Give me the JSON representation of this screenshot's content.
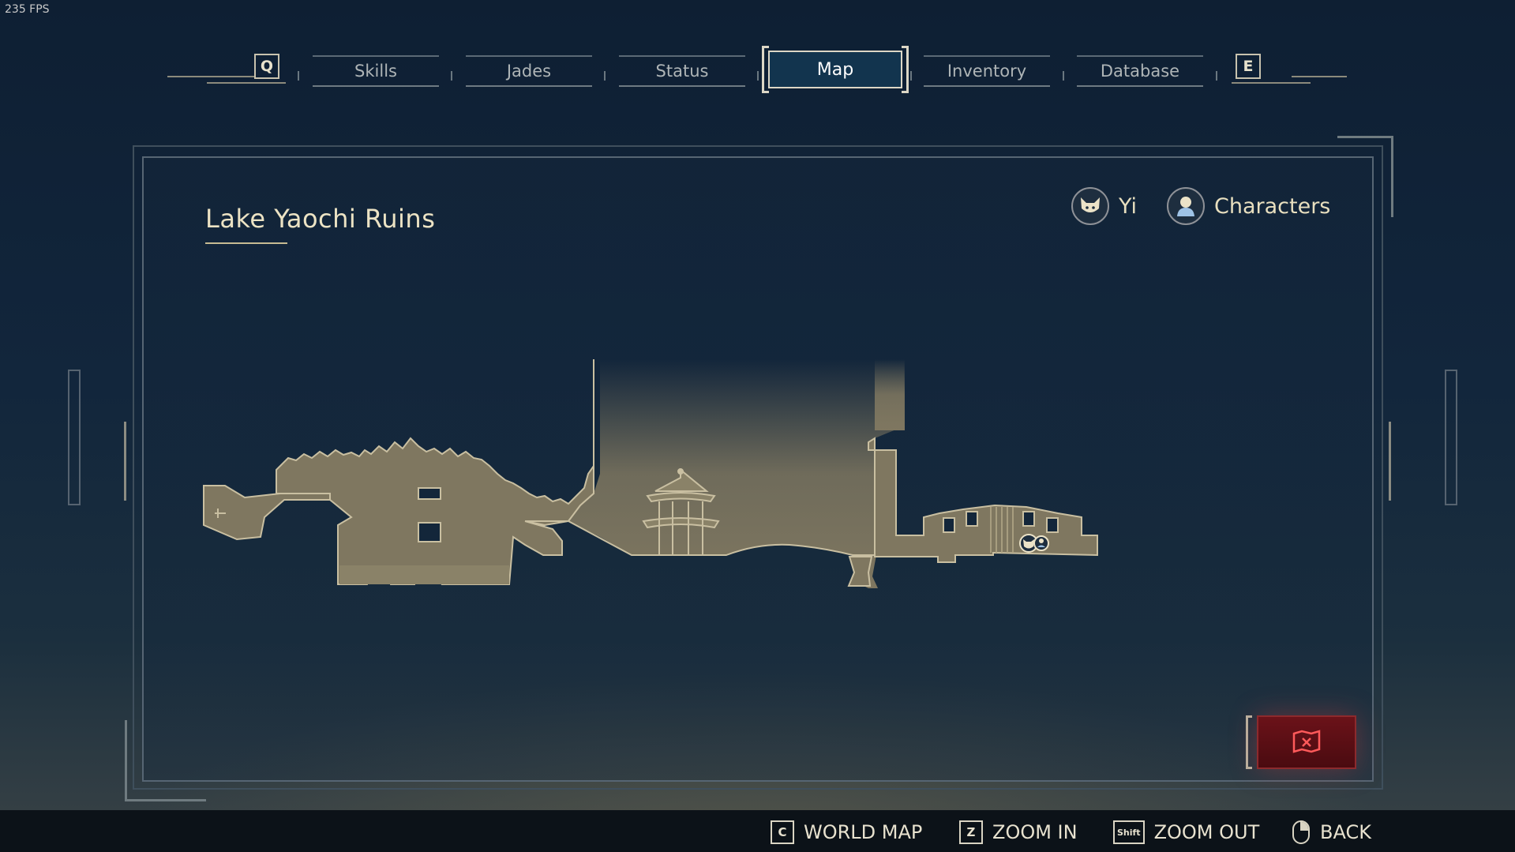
{
  "fps": "235 FPS",
  "nav": {
    "prev_key": "Q",
    "next_key": "E",
    "tabs": [
      {
        "label": "Skills",
        "active": false
      },
      {
        "label": "Jades",
        "active": false
      },
      {
        "label": "Status",
        "active": false
      },
      {
        "label": "Map",
        "active": true
      },
      {
        "label": "Inventory",
        "active": false
      },
      {
        "label": "Database",
        "active": false
      }
    ]
  },
  "map": {
    "region_title": "Lake Yaochi Ruins",
    "legend": [
      {
        "label": "Yi",
        "icon": "cat-face-icon"
      },
      {
        "label": "Characters",
        "icon": "character-bust-icon"
      }
    ],
    "colors": {
      "terrain": "#7f7760",
      "terrain_edge": "#c9bfa1",
      "background": "#13263a"
    }
  },
  "hints": [
    {
      "key": "C",
      "label": "WORLD MAP"
    },
    {
      "key": "Z",
      "label": "ZOOM IN"
    },
    {
      "key": "Shift",
      "label": "ZOOM OUT"
    },
    {
      "key": "",
      "label": "BACK",
      "icon": "mouse-right-icon"
    }
  ]
}
